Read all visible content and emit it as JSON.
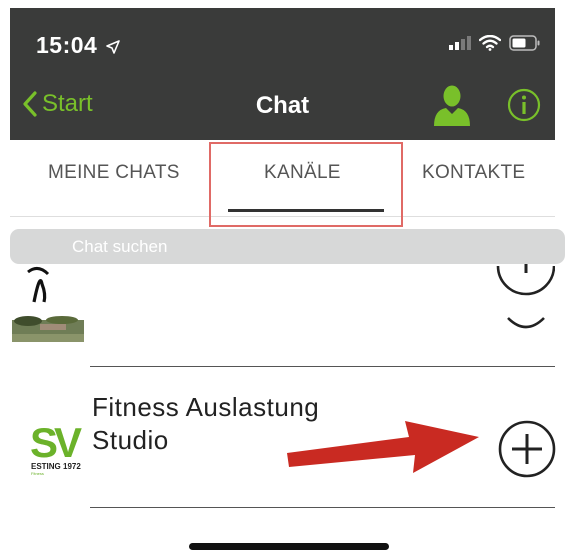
{
  "status_bar": {
    "time": "15:04",
    "icons": [
      "location-arrow-icon",
      "signal-icon",
      "wifi-icon",
      "battery-icon"
    ]
  },
  "nav": {
    "back_label": "Start",
    "title": "Chat",
    "accent_color": "#79c02a",
    "icons": [
      "person-icon",
      "info-icon"
    ]
  },
  "tabs": {
    "items": [
      {
        "label": "MEINE CHATS",
        "selected": false
      },
      {
        "label": "KANÄLE",
        "selected": true
      },
      {
        "label": "KONTAKTE",
        "selected": false
      }
    ]
  },
  "search": {
    "placeholder": "Chat suchen"
  },
  "channels": [
    {
      "title_line1": "Fitness Auslastung",
      "title_line2": "Studio",
      "logo_text": "SV",
      "logo_subtext": "ESTING 1972",
      "action_icon": "plus-circle-icon"
    }
  ],
  "annotations": {
    "highlight_color": "#e06a66",
    "arrow_color": "#c92a22"
  }
}
